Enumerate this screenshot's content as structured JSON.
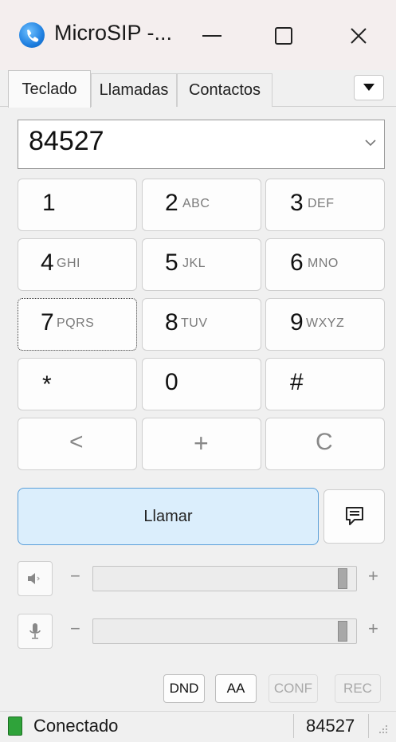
{
  "window": {
    "title": "MicroSIP -..."
  },
  "tabs": [
    {
      "label": "Teclado",
      "active": true
    },
    {
      "label": "Llamadas"
    },
    {
      "label": "Contactos"
    }
  ],
  "number_input": {
    "value": "84527"
  },
  "keypad": [
    {
      "digit": "1",
      "letters": ""
    },
    {
      "digit": "2",
      "letters": "ABC"
    },
    {
      "digit": "3",
      "letters": "DEF"
    },
    {
      "digit": "4",
      "letters": "GHI"
    },
    {
      "digit": "5",
      "letters": "JKL"
    },
    {
      "digit": "6",
      "letters": "MNO"
    },
    {
      "digit": "7",
      "letters": "PQRS"
    },
    {
      "digit": "8",
      "letters": "TUV"
    },
    {
      "digit": "9",
      "letters": "WXYZ"
    },
    {
      "digit": "*",
      "letters": ""
    },
    {
      "digit": "0",
      "letters": ""
    },
    {
      "digit": "#",
      "letters": ""
    },
    {
      "digit": "<",
      "letters": ""
    },
    {
      "digit": "+",
      "letters": ""
    },
    {
      "digit": "C",
      "letters": ""
    }
  ],
  "call": {
    "label": "Llamar"
  },
  "sliders": {
    "speaker": {
      "minus": "−",
      "plus": "+",
      "level": 0.97
    },
    "microphone": {
      "minus": "−",
      "plus": "+",
      "level": 0.97
    }
  },
  "bottom_buttons": [
    {
      "label": "DND",
      "enabled": true
    },
    {
      "label": "AA",
      "enabled": true
    },
    {
      "label": "CONF",
      "enabled": false
    },
    {
      "label": "REC",
      "enabled": false
    }
  ],
  "status": {
    "text": "Conectado",
    "number": "84527"
  },
  "colors": {
    "call_button_bg": "#dbeefc",
    "status_green": "#2fa33a",
    "accent": "#1f7fe0"
  },
  "icons": {
    "app": "microsip-phone-icon",
    "minimize": "minimize-icon",
    "maximize": "maximize-icon",
    "close": "close-icon",
    "tabs_menu": "caret-down-icon",
    "message": "chat-bubble-icon",
    "speaker": "speaker-icon",
    "microphone": "microphone-icon",
    "status": "connected-icon"
  }
}
